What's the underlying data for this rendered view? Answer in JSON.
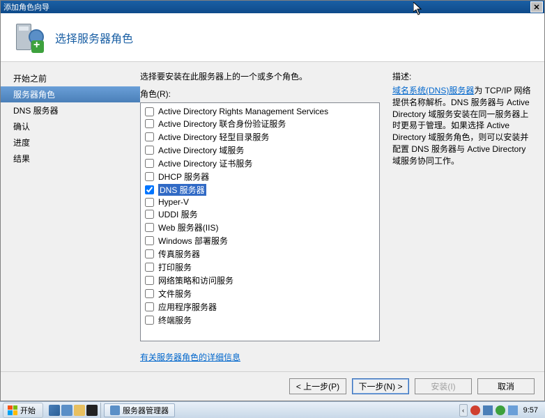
{
  "window": {
    "title": "添加角色向导",
    "header": "选择服务器角色"
  },
  "nav": {
    "items": [
      {
        "label": "开始之前",
        "active": false
      },
      {
        "label": "服务器角色",
        "active": true
      },
      {
        "label": "DNS 服务器",
        "active": false
      },
      {
        "label": "确认",
        "active": false
      },
      {
        "label": "进度",
        "active": false
      },
      {
        "label": "结果",
        "active": false
      }
    ]
  },
  "content": {
    "instruction": "选择要安装在此服务器上的一个或多个角色。",
    "roles_label": "角色(R):",
    "roles": [
      {
        "label": "Active Directory Rights Management Services",
        "checked": false,
        "selected": false
      },
      {
        "label": "Active Directory 联合身份验证服务",
        "checked": false,
        "selected": false
      },
      {
        "label": "Active Directory 轻型目录服务",
        "checked": false,
        "selected": false
      },
      {
        "label": "Active Directory 域服务",
        "checked": false,
        "selected": false
      },
      {
        "label": "Active Directory 证书服务",
        "checked": false,
        "selected": false
      },
      {
        "label": "DHCP 服务器",
        "checked": false,
        "selected": false
      },
      {
        "label": "DNS 服务器",
        "checked": true,
        "selected": true
      },
      {
        "label": "Hyper-V",
        "checked": false,
        "selected": false
      },
      {
        "label": "UDDI 服务",
        "checked": false,
        "selected": false
      },
      {
        "label": "Web 服务器(IIS)",
        "checked": false,
        "selected": false
      },
      {
        "label": "Windows 部署服务",
        "checked": false,
        "selected": false
      },
      {
        "label": "传真服务器",
        "checked": false,
        "selected": false
      },
      {
        "label": "打印服务",
        "checked": false,
        "selected": false
      },
      {
        "label": "网络策略和访问服务",
        "checked": false,
        "selected": false
      },
      {
        "label": "文件服务",
        "checked": false,
        "selected": false
      },
      {
        "label": "应用程序服务器",
        "checked": false,
        "selected": false
      },
      {
        "label": "终端服务",
        "checked": false,
        "selected": false
      }
    ],
    "more_link": "有关服务器角色的详细信息",
    "desc_title": "描述:",
    "desc_link": "域名系统(DNS)服务器",
    "desc_body": "为 TCP/IP 网络提供名称解析。DNS 服务器与 Active Directory 域服务安装在同一服务器上时更易于管理。如果选择 Active Directory 域服务角色，则可以安装并配置 DNS 服务器与 Active Directory 域服务协同工作。"
  },
  "footer": {
    "prev": "< 上一步(P)",
    "next": "下一步(N) >",
    "install": "安装(I)",
    "cancel": "取消"
  },
  "taskbar": {
    "start": "开始",
    "task": "服务器管理器",
    "clock": "9:57"
  }
}
